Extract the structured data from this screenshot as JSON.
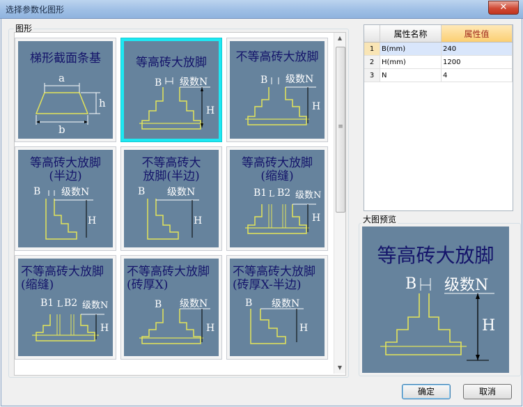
{
  "window": {
    "title": "选择参数化图形",
    "close_glyph": "✕"
  },
  "shapes_group": {
    "label": "图形"
  },
  "shapes": [
    {
      "title": "梯形截面条基",
      "labels": [
        "a",
        "h",
        "b"
      ]
    },
    {
      "title": "等高砖大放脚",
      "labels": [
        "B",
        "级数N",
        "H"
      ]
    },
    {
      "title": "不等高砖大放脚",
      "labels": [
        "B",
        "级数N",
        "H"
      ]
    },
    {
      "title": "等高砖大放脚\n(半边)",
      "labels": [
        "B",
        "级数N",
        "H"
      ]
    },
    {
      "title": "不等高砖大\n放脚(半边)",
      "labels": [
        "B",
        "级数N",
        "H"
      ]
    },
    {
      "title": "等高砖大放脚\n(缩缝)",
      "labels": [
        "B1",
        "L",
        "B2",
        "级数N",
        "H"
      ]
    },
    {
      "title": "不等高砖大放脚\n(缩缝)",
      "labels": [
        "B1",
        "L",
        "B2",
        "级数N",
        "H"
      ]
    },
    {
      "title": "不等高砖大放脚\n(砖厚X)",
      "labels": [
        "B",
        "级数N",
        "H"
      ]
    },
    {
      "title": "不等高砖大放脚\n(砖厚X-半边)",
      "labels": [
        "B",
        "级数N",
        "H"
      ]
    }
  ],
  "selected_shape_index": 1,
  "properties": {
    "headers": [
      "属性名称",
      "属性值"
    ],
    "rows": [
      {
        "index": "1",
        "name": "B(mm)",
        "value": "240"
      },
      {
        "index": "2",
        "name": "H(mm)",
        "value": "1200"
      },
      {
        "index": "3",
        "name": "N",
        "value": "4"
      }
    ],
    "selected_row": 1
  },
  "preview": {
    "label": "大图预览",
    "title": "等高砖大放脚",
    "labels": [
      "B",
      "级数N",
      "H"
    ]
  },
  "buttons": {
    "ok": "确定",
    "cancel": "取消"
  },
  "scrollbar": {
    "up_glyph": "▲",
    "down_glyph": "▼",
    "grip_glyph": "≡"
  }
}
